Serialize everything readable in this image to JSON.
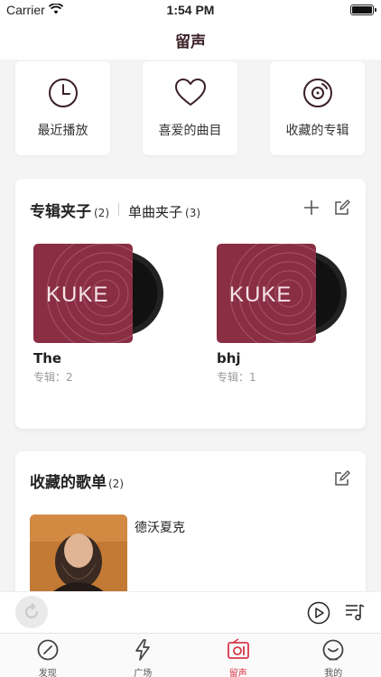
{
  "status_bar": {
    "carrier": "Carrier",
    "time": "1:54 PM"
  },
  "nav": {
    "title": "留声"
  },
  "quick_actions": [
    {
      "label": "最近播放",
      "icon": "clock-icon"
    },
    {
      "label": "喜爱的曲目",
      "icon": "heart-icon"
    },
    {
      "label": "收藏的专辑",
      "icon": "vinyl-icon"
    }
  ],
  "album_folders": {
    "tab_album": "专辑夹子",
    "tab_album_count": "(2)",
    "tab_single": "单曲夹子",
    "tab_single_count": "(3)",
    "items": [
      {
        "title": "The",
        "count": "专辑：2",
        "cover_text": "KUKE"
      },
      {
        "title": "bhj",
        "count": "专辑：1",
        "cover_text": "KUKE"
      }
    ]
  },
  "playlists": {
    "title": "收藏的歌单",
    "count": "(2)",
    "items": [
      {
        "name": "德沃夏克"
      }
    ]
  },
  "tab_bar": [
    {
      "label": "发现",
      "icon": "compass-icon"
    },
    {
      "label": "广场",
      "icon": "lightning-icon"
    },
    {
      "label": "留声",
      "icon": "radio-icon"
    },
    {
      "label": "我的",
      "icon": "profile-icon"
    }
  ],
  "colors": {
    "brand": "#d8384a",
    "cover": "#8a2e44",
    "title": "#3a1f25"
  }
}
